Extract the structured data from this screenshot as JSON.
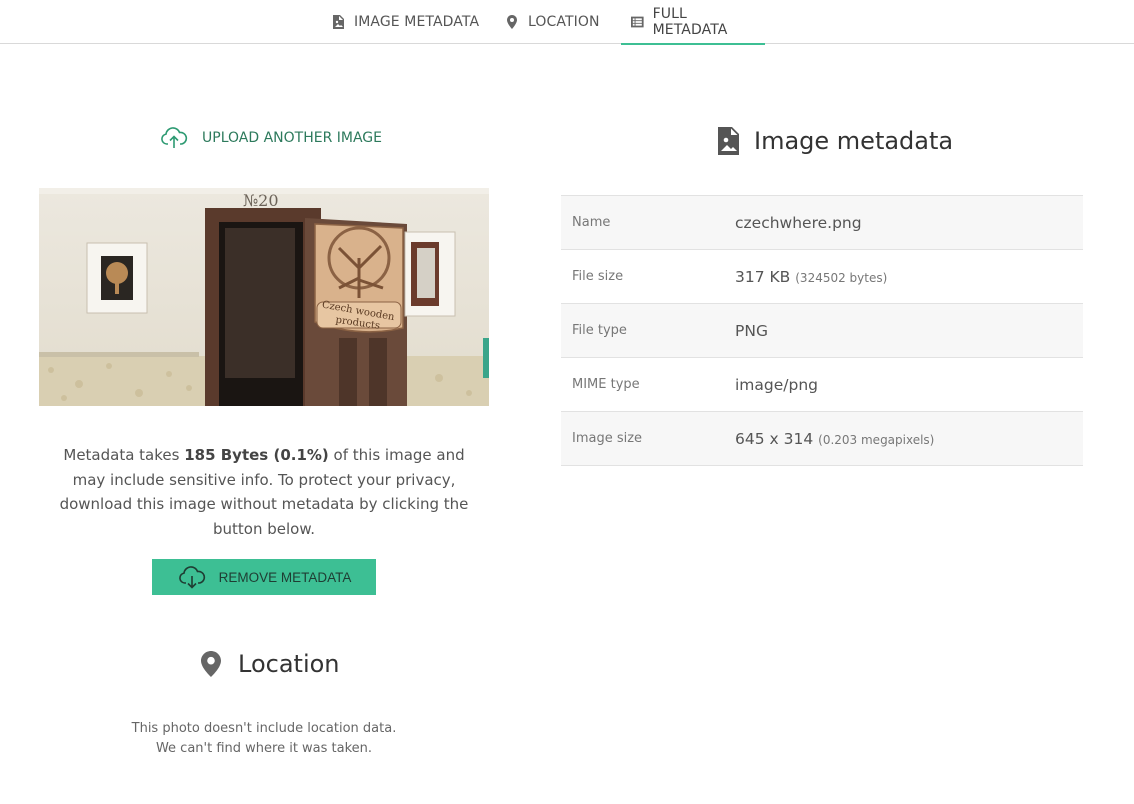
{
  "tabs": [
    {
      "label": "IMAGE METADATA",
      "icon": "image-file-icon"
    },
    {
      "label": "LOCATION",
      "icon": "map-pin-icon"
    },
    {
      "label": "FULL METADATA",
      "icon": "list-icon",
      "active": true
    }
  ],
  "upload": {
    "label": "UPLOAD ANOTHER IMAGE",
    "icon": "cloud-upload-icon"
  },
  "photo": {
    "sign_text_line1": "Czech wooden",
    "sign_text_line2": "products",
    "house_number": "№20"
  },
  "info": {
    "prefix": "Metadata takes ",
    "highlight": "185 Bytes (0.1%)",
    "suffix": " of this image and may include sensitive info. To protect your privacy, download this image without metadata by clicking the button below."
  },
  "remove": {
    "label": "REMOVE METADATA",
    "icon": "cloud-download-icon"
  },
  "location": {
    "title": "Location",
    "line1": "This photo doesn't include location data.",
    "line2": "We can't find where it was taken."
  },
  "metadata": {
    "title": "Image metadata",
    "rows": [
      {
        "key": "Name",
        "value": "czechwhere.png",
        "extra": ""
      },
      {
        "key": "File size",
        "value": "317 KB",
        "extra": "(324502 bytes)"
      },
      {
        "key": "File type",
        "value": "PNG",
        "extra": ""
      },
      {
        "key": "MIME type",
        "value": "image/png",
        "extra": ""
      },
      {
        "key": "Image size",
        "value": "645 x 314",
        "extra": "(0.203 megapixels)"
      }
    ]
  },
  "colors": {
    "accent": "#3dbf94",
    "link": "#2d7a5c"
  }
}
